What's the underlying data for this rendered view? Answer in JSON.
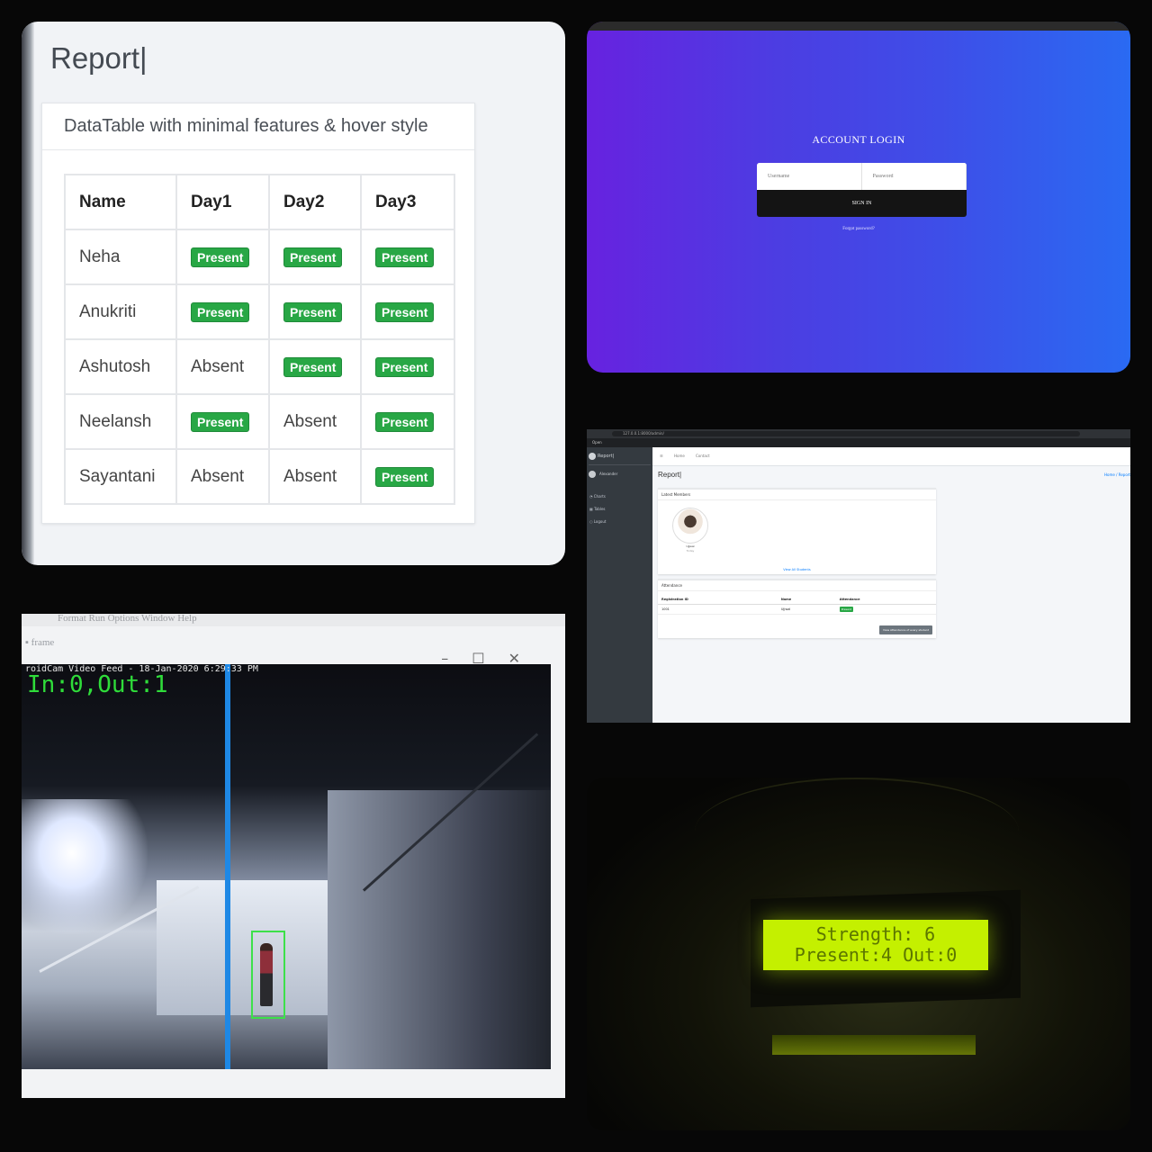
{
  "report": {
    "title": "Report|",
    "card_title": "DataTable with minimal features & hover style",
    "columns": [
      "Name",
      "Day1",
      "Day2",
      "Day3"
    ],
    "rows": [
      [
        "Neha",
        "Present",
        "Present",
        "Present"
      ],
      [
        "Anukriti",
        "Present",
        "Present",
        "Present"
      ],
      [
        "Ashutosh",
        "Absent",
        "Present",
        "Present"
      ],
      [
        "Neelansh",
        "Present",
        "Absent",
        "Present"
      ],
      [
        "Sayantani",
        "Absent",
        "Absent",
        "Present"
      ]
    ],
    "present_color": "#28a745"
  },
  "login": {
    "title": "ACCOUNT LOGIN",
    "username_placeholder": "Username",
    "password_placeholder": "Password",
    "signin_label": "SIGN IN",
    "forgot_label": "Forgot password?"
  },
  "dashboard": {
    "url": "127.0.0.1:8000/admin/",
    "tab": "Open",
    "brand": "Report|",
    "user": "Alexander",
    "nav": [
      "Charts",
      "Tables",
      "Logout"
    ],
    "topnav": [
      "Home",
      "Contact"
    ],
    "page_title": "Report|",
    "breadcrumb": "Home / Report",
    "members_title": "Latest Members",
    "member_name": "Ujjwal",
    "member_date": "Today",
    "view_all": "View All Students",
    "attendance_title": "Attendance",
    "attendance_columns": [
      "Registration ID",
      "Name",
      "Attendance"
    ],
    "attendance_row": [
      "1001",
      "Ujjwal",
      "Present"
    ],
    "view_button": "View Attendance of every student"
  },
  "camera": {
    "menu": "Format   Run   Options   Window   Help",
    "window_title": "frame",
    "feed_label": "roidCam Video Feed - 18-Jan-2020  6:29:33 PM",
    "counter": "In:0,Out:1"
  },
  "lcd": {
    "line1": "Strength: 6",
    "line2": "Present:4 Out:0",
    "backlight_color": "#c4f000"
  }
}
